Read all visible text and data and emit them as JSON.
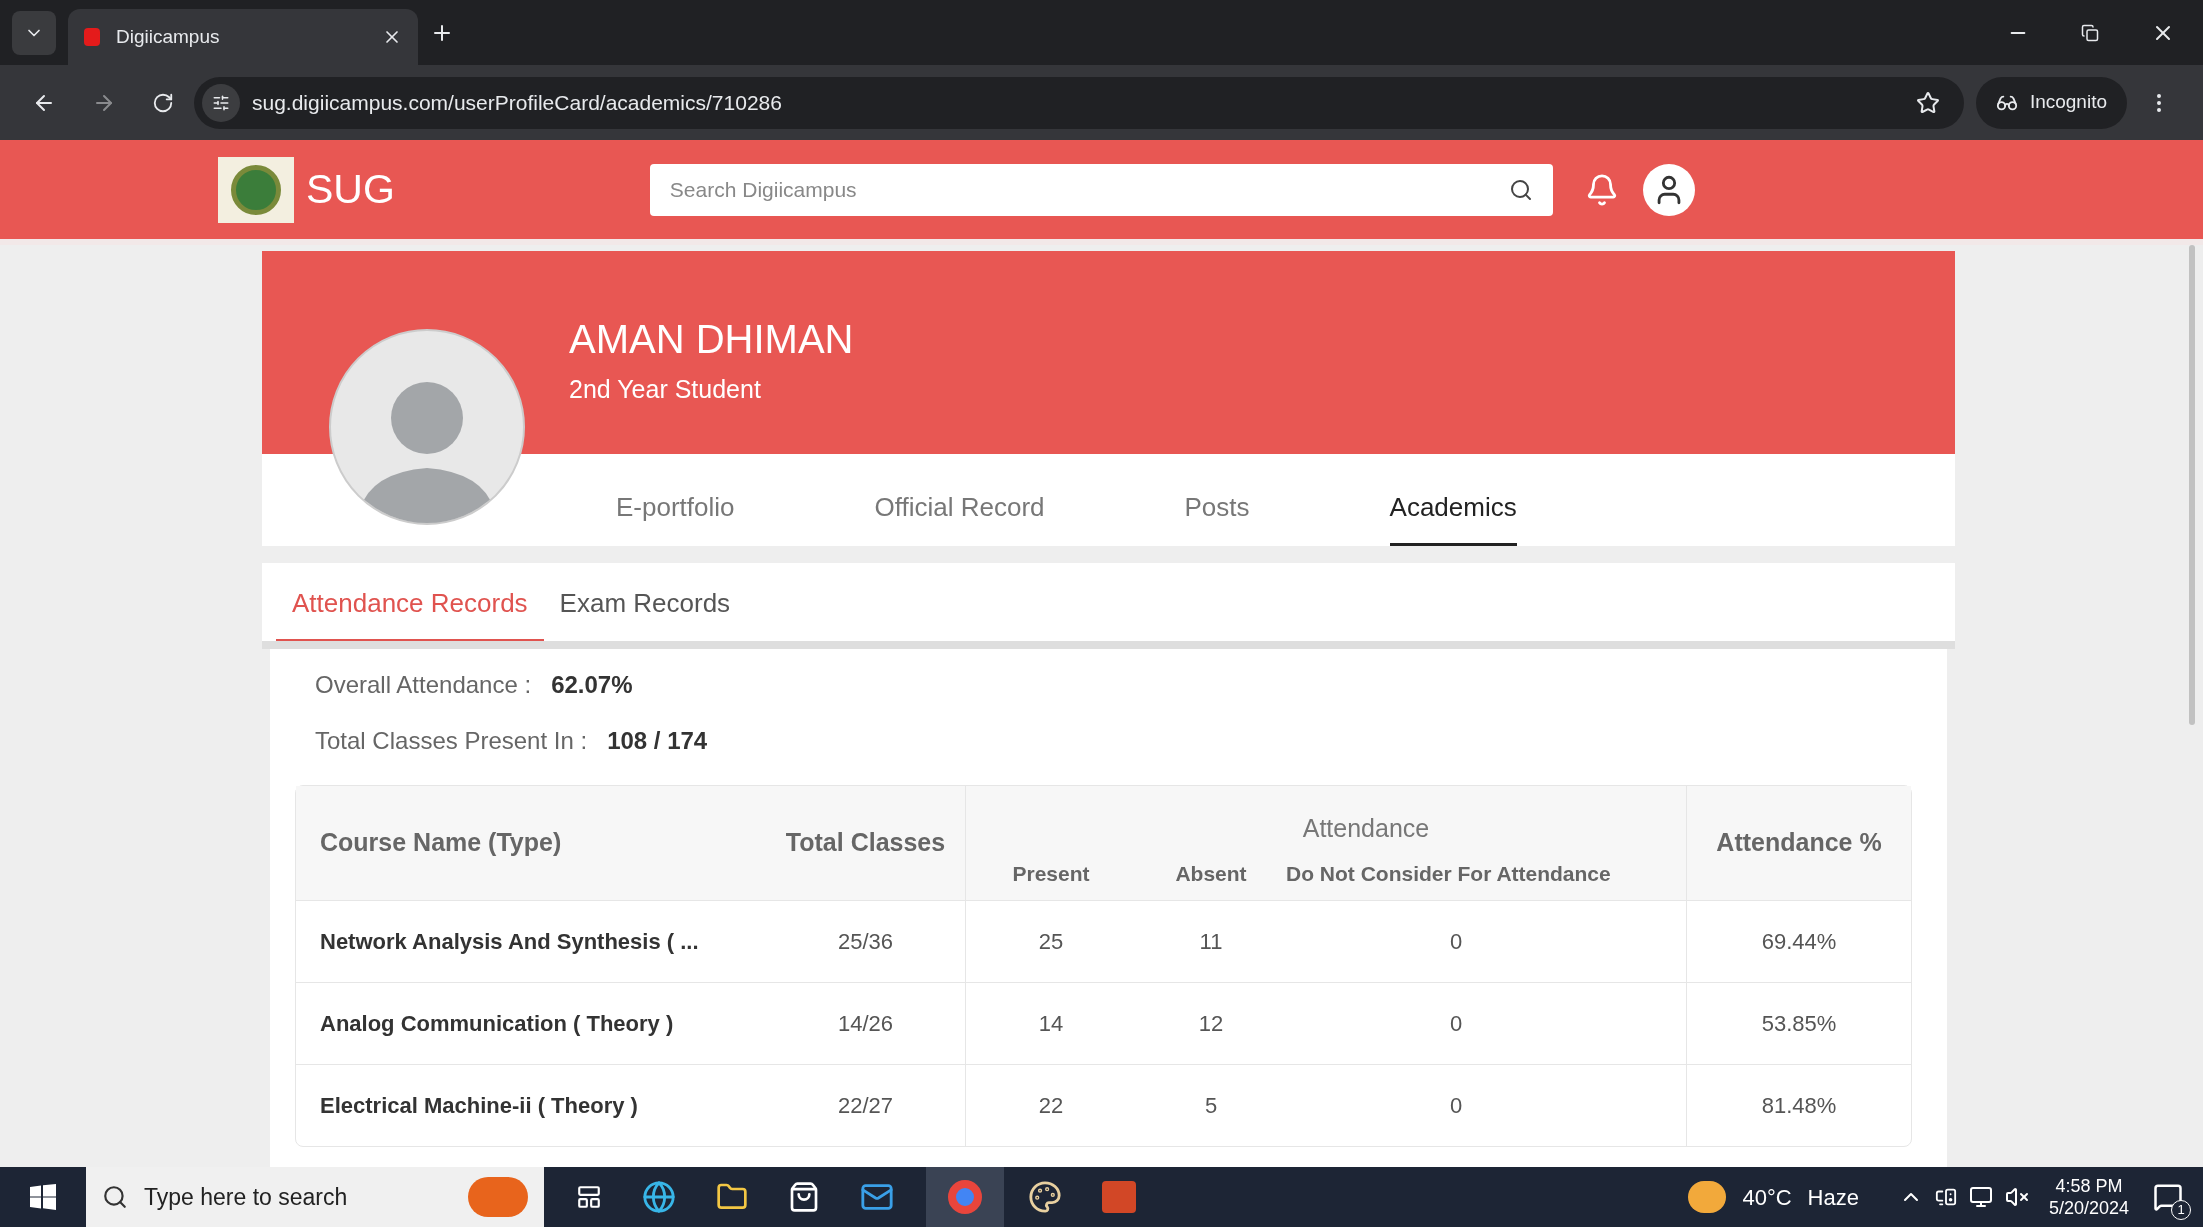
{
  "browser": {
    "tabs": [
      {
        "title": "Digiicampus",
        "selected": true
      }
    ],
    "url": "sug.digiicampus.com/userProfileCard/academics/710286",
    "incognito": "Incognito"
  },
  "header": {
    "brand": "SUG",
    "search": {
      "placeholder": "Search Digiicampus"
    }
  },
  "profile": {
    "name": "AMAN DHIMAN",
    "subtitle": "2nd Year Student",
    "tabs": [
      {
        "label": "E-portfolio",
        "selected": false
      },
      {
        "label": "Official Record",
        "selected": false
      },
      {
        "label": "Posts",
        "selected": false
      },
      {
        "label": "Academics",
        "selected": true
      }
    ]
  },
  "subtabs": [
    {
      "label": "Attendance Records",
      "selected": true
    },
    {
      "label": "Exam Records",
      "selected": false
    }
  ],
  "summary": [
    {
      "label": "Overall Attendance :",
      "value": "62.07%"
    },
    {
      "label": "Total Classes Present In :",
      "value": "108 / 174"
    }
  ],
  "table": {
    "group_heading": "Attendance",
    "columns": [
      "Course Name (Type)",
      "Total Classes",
      "Present",
      "Absent",
      "Do Not Consider For Attendance",
      "Attendance %"
    ],
    "rows": [
      {
        "cells": [
          "Network Analysis And Synthesis ( ...",
          "25/36",
          "25",
          "11",
          "0",
          "69.44%"
        ]
      },
      {
        "cells": [
          "Analog Communication ( Theory )",
          "14/26",
          "14",
          "12",
          "0",
          "53.85%"
        ]
      },
      {
        "cells": [
          "Electrical Machine-ii ( Theory )",
          "22/27",
          "22",
          "5",
          "0",
          "81.48%"
        ]
      }
    ]
  },
  "taskbar": {
    "search_placeholder": "Type here to search",
    "temperature": "40°C",
    "weather": "Haze",
    "time": "4:58 PM",
    "date": "5/20/2024",
    "notifications": "1"
  }
}
